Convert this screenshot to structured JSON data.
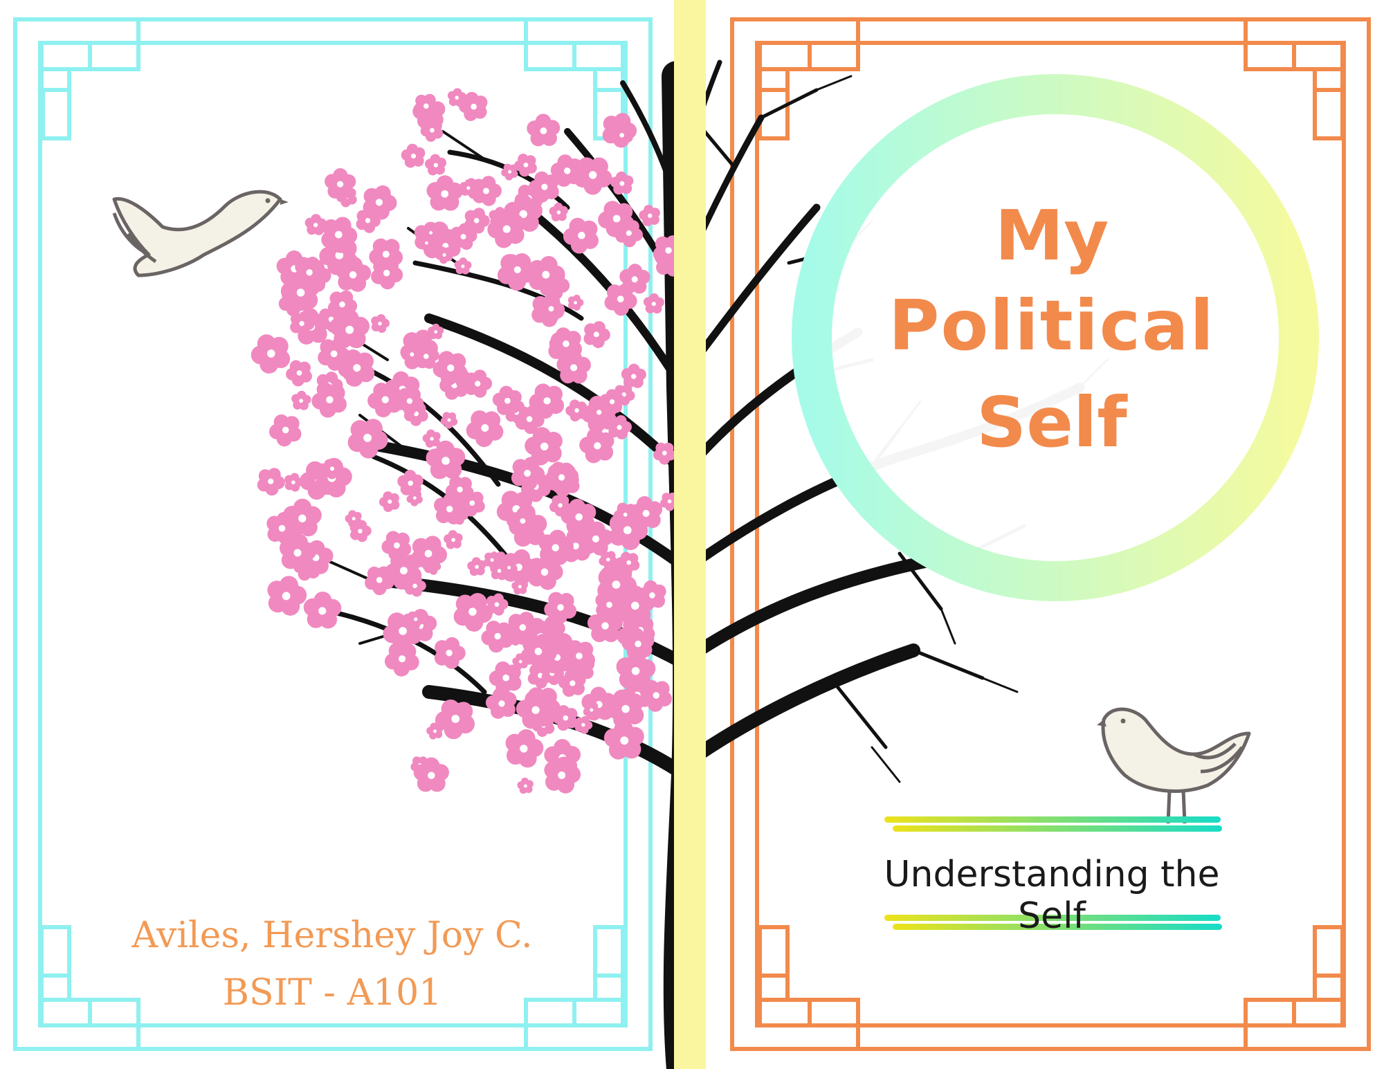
{
  "cover": {
    "title_lines": [
      "My",
      "Political",
      "Self"
    ],
    "subtitle": "Understanding the Self",
    "author_name": "Aviles, Hershey Joy C.",
    "author_section": "BSIT - A101"
  },
  "colors": {
    "left_frame": "#8ff0f0",
    "right_frame": "#f28a4c",
    "blossom": "#f089c0",
    "spine": "#faf6a0",
    "trunk": "#111111",
    "title_text": "#f28a4c",
    "author_text": "#f29a55",
    "ring_start": "#a6fbe8",
    "ring_end": "#f5fa9e",
    "bar_start": "#ede21a",
    "bar_end": "#16dcc8"
  },
  "icons": [
    "dove-flying-icon",
    "dove-perched-icon",
    "cherry-blossom-tree-icon",
    "bare-tree-icon",
    "lattice-corner-icon"
  ]
}
